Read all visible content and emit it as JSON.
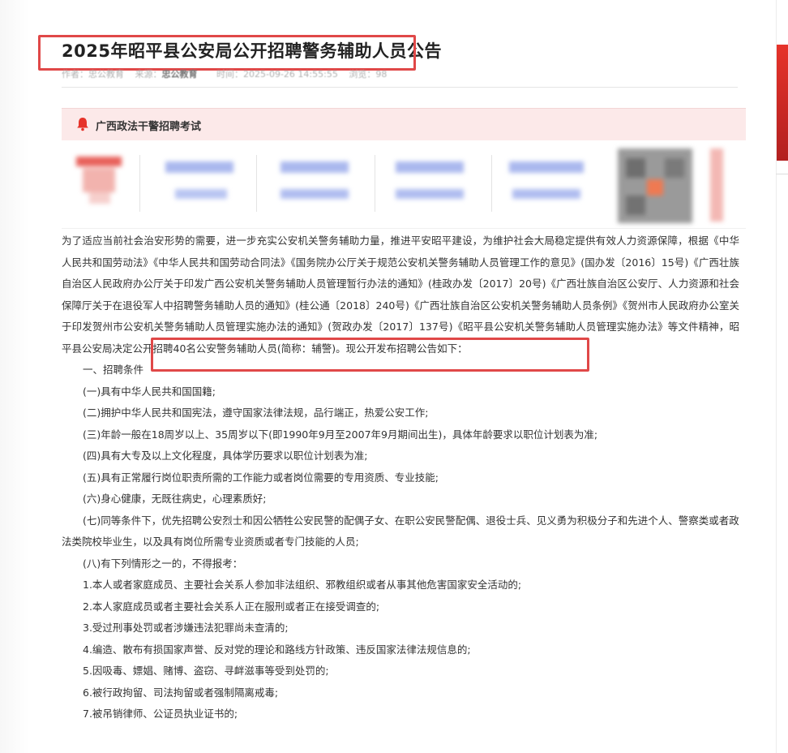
{
  "article": {
    "title": "2025年昭平县公安局公开招聘警务辅助人员公告",
    "meta_author": "作者：忠公教育",
    "meta_source_label": "来源：",
    "meta_source": "忠公教育",
    "meta_time": "时间：2025-09-26 14:55:55",
    "meta_views": "浏览：98"
  },
  "ad": {
    "title": "广西政法干警招聘考试",
    "icon": "bell-icon",
    "accent_color": "#e6332a"
  },
  "body": {
    "intro": "为了适应当前社会治安形势的需要，进一步充实公安机关警务辅助力量，推进平安昭平建设，为维护社会大局稳定提供有效人力资源保障，根据《中华人民共和国劳动法》《中华人民共和国劳动合同法》《国务院办公厅关于规范公安机关警务辅助人员管理工作的意见》(国办发〔2016〕15号)《广西壮族自治区人民政府办公厅关于印发广西公安机关警务辅助人员管理暂行办法的通知》(桂政办发〔2017〕20号)《广西壮族自治区公安厅、人力资源和社会保障厅关于在退役军人中招聘警务辅助人员的通知》(桂公通〔2018〕240号)《广西壮族自治区公安机关警务辅助人员条例》《贺州市人民政府办公室关于印发贺州市公安机关警务辅助人员管理实施办法的通知》(贺政办发〔2017〕137号)《昭平县公安机关警务辅助人员管理实施办法》等文件精神，",
    "intro_highlight": "昭平县公安局决定公开招聘40名公安警务辅助人员(简称：辅警)。现公开发布招聘公告如下：",
    "section1": "一、招聘条件",
    "c1": "(一)具有中华人民共和国国籍;",
    "c2": "(二)拥护中华人民共和国宪法，遵守国家法律法规，品行端正，热爱公安工作;",
    "c3": "(三)年龄一般在18周岁以上、35周岁以下(即1990年9月至2007年9月期间出生)，具体年龄要求以职位计划表为准;",
    "c4": "(四)具有大专及以上文化程度，具体学历要求以职位计划表为准;",
    "c5": "(五)具有正常履行岗位职责所需的工作能力或者岗位需要的专用资质、专业技能;",
    "c6": "(六)身心健康，无既往病史，心理素质好;",
    "c7": "(七)同等条件下，优先招聘公安烈士和因公牺牲公安民警的配偶子女、在职公安民警配偶、退役士兵、见义勇为积极分子和先进个人、警察类或者政法类院校毕业生，以及具有岗位所需专业资质或者专门技能的人员;",
    "c8": "(八)有下列情形之一的，不得报考：",
    "n1": "1.本人或者家庭成员、主要社会关系人参加非法组织、邪教组织或者从事其他危害国家安全活动的;",
    "n2": "2.本人家庭成员或者主要社会关系人正在服刑或者正在接受调查的;",
    "n3": "3.受过刑事处罚或者涉嫌违法犯罪尚未查清的;",
    "n4": "4.编造、散布有损国家声誉、反对党的理论和路线方针政策、违反国家法律法规信息的;",
    "n5": "5.因吸毒、嫖娼、赌博、盗窃、寻衅滋事等受到处罚的;",
    "n6": "6.被行政拘留、司法拘留或者强制隔离戒毒;",
    "n7": "7.被吊销律师、公证员执业证书的;"
  },
  "colors": {
    "highlight_box": "#e04848",
    "banner_bg": "#fce9e9",
    "brand_red": "#e6332a"
  }
}
